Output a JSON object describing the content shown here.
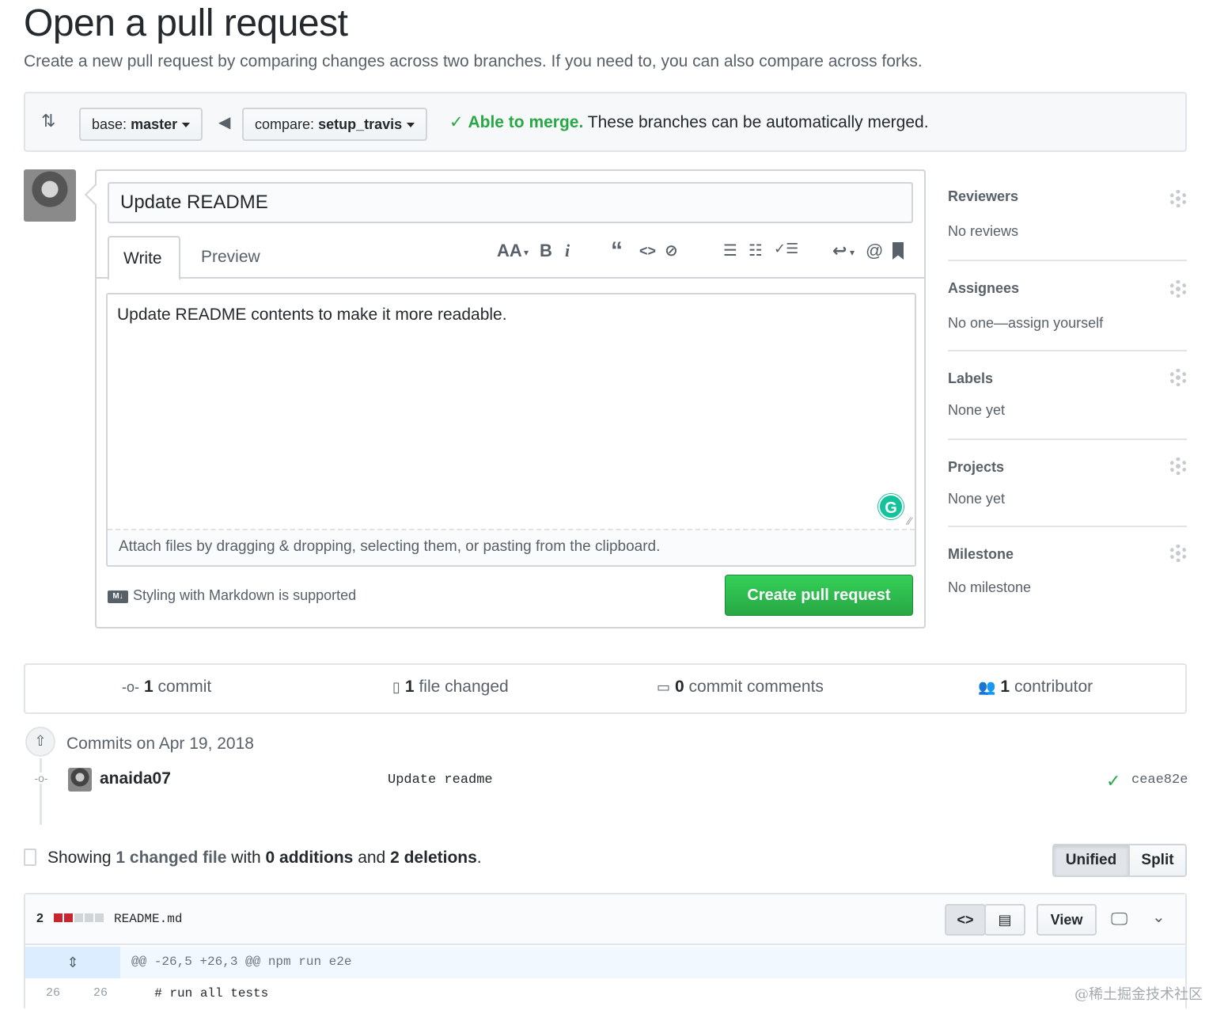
{
  "header": {
    "title": "Open a pull request",
    "subtitle": "Create a new pull request by comparing changes across two branches. If you need to, you can also compare across forks."
  },
  "compare": {
    "base_label": "base:",
    "base_value": "master",
    "compare_label": "compare:",
    "compare_value": "setup_travis",
    "merge_ok": "Able to merge.",
    "merge_detail": "These branches can be automatically merged."
  },
  "form": {
    "title_value": "Update README",
    "tabs": {
      "write": "Write",
      "preview": "Preview"
    },
    "toolbar": {
      "heading": "AA",
      "bold": "B",
      "italic": "i",
      "quote": "“",
      "code": "<>",
      "link": "⊘",
      "ul": "☰",
      "ol": "☷",
      "tasks": "✓☰",
      "reply": "↩",
      "mention": "@",
      "saved": "🔖"
    },
    "body_value": "Update README contents to make it more readable.",
    "attach_hint": "Attach files by dragging & dropping, selecting them, or pasting from the clipboard.",
    "markdown_badge": "M↓",
    "markdown_note": "Styling with Markdown is supported",
    "submit_label": "Create pull request",
    "grammarly": "G"
  },
  "sidebar": {
    "sections": [
      {
        "title": "Reviewers",
        "value": "No reviews"
      },
      {
        "title": "Assignees",
        "value": "No one—assign yourself"
      },
      {
        "title": "Labels",
        "value": "None yet"
      },
      {
        "title": "Projects",
        "value": "None yet"
      },
      {
        "title": "Milestone",
        "value": "No milestone"
      }
    ]
  },
  "stats": {
    "commits": {
      "count": "1",
      "label": "commit"
    },
    "files": {
      "count": "1",
      "label": "file changed"
    },
    "comments": {
      "count": "0",
      "label": "commit comments"
    },
    "contributors": {
      "count": "1",
      "label": "contributor"
    }
  },
  "commits": {
    "heading": "Commits on Apr 19, 2018",
    "items": [
      {
        "author": "anaida07",
        "message": "Update readme",
        "sha": "ceae82e"
      }
    ]
  },
  "summary": {
    "showing": "Showing",
    "changed": "1 changed file",
    "with": "with",
    "additions": "0 additions",
    "and": "and",
    "deletions": "2 deletions",
    "period": "."
  },
  "diff_view": {
    "unified": "Unified",
    "split": "Split"
  },
  "file": {
    "change_count": "2",
    "name": "README.md",
    "view_label": "View",
    "hunk_header": "@@ -26,5 +26,3 @@ npm run e2e",
    "lines": [
      {
        "old": "26",
        "new": "26",
        "code": "  # run all tests"
      }
    ]
  },
  "watermark": "@稀土掘金技术社区",
  "colors": {
    "accent_green": "#28a745",
    "text_primary": "#24292e",
    "text_muted": "#586069",
    "border": "#d1d5da"
  }
}
